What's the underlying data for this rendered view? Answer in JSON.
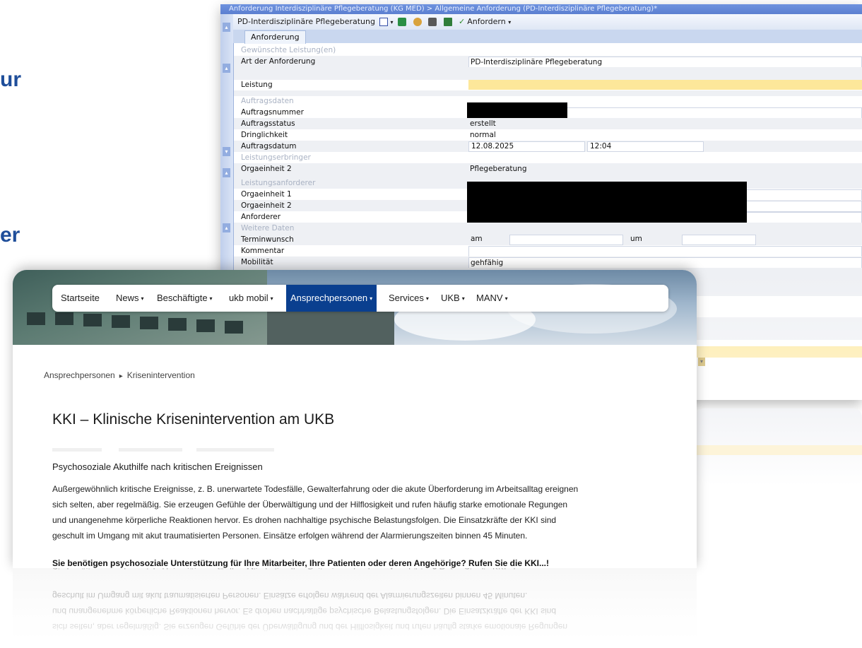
{
  "slide": {
    "fragment_top": "ur",
    "fragment_bottom": "er"
  },
  "order_form": {
    "window_title": "Anforderung Interdisziplinäre Pflegeberatung (KG MED) > Allgemeine Anforderung (PD-Interdisziplinäre Pflegeberatung)*",
    "toolbar": {
      "form_name": "PD-Interdisziplinäre Pflegeberatung",
      "request_button": "Anfordern"
    },
    "tab_label": "Anforderung",
    "sections": {
      "requested_services": "Gewünschte Leistung(en)",
      "order_data": "Auftragsdaten",
      "service_provider": "Leistungserbringer",
      "service_requester": "Leistungsanforderer",
      "additional_data": "Weitere Daten"
    },
    "labels": {
      "request_type": "Art der Anforderung",
      "service": "Leistung",
      "order_number": "Auftragsnummer",
      "order_status": "Auftragsstatus",
      "urgency": "Dringlichkeit",
      "order_date": "Auftragsdatum",
      "org_unit_2_provider": "Orgaeinheit 2",
      "org_unit_1": "Orgaeinheit 1",
      "org_unit_2": "Orgaeinheit 2",
      "requester": "Anforderer",
      "appointment_wish": "Terminwunsch",
      "comment": "Kommentar",
      "mobility": "Mobilität"
    },
    "values": {
      "request_type": "PD-Interdisziplinäre Pflegeberatung",
      "order_status": "erstellt",
      "urgency": "normal",
      "order_date": "12.08.2025",
      "order_time": "12:04",
      "provider_org_unit": "Pflegeberatung",
      "appointment_am": "am",
      "appointment_um": "um",
      "mobility": "gehfähig"
    }
  },
  "intranet": {
    "nav": [
      {
        "label": "Startseite",
        "caret": false
      },
      {
        "label": "News",
        "caret": true
      },
      {
        "label": "Beschäftigte",
        "caret": true
      },
      {
        "label": "ukb mobil",
        "caret": true
      },
      {
        "label": "Ansprechpersonen",
        "caret": true,
        "active": true
      },
      {
        "label": "Services",
        "caret": true
      },
      {
        "label": "UKB",
        "caret": true
      },
      {
        "label": "MANV",
        "caret": true
      }
    ],
    "breadcrumb": {
      "parent": "Ansprechpersonen",
      "current": "Krisenintervention"
    },
    "title": "KKI – Klinische Krisenintervention am UKB",
    "section_heading": "Psychosoziale Akuthilfe nach kritischen Ereignissen",
    "body_lines": [
      "Außergewöhnlich kritische Ereignisse, z. B. unerwartete Todesfälle, Gewalterfahrung oder die akute Überforderung im Arbeitsalltag ereignen",
      "sich selten, aber regelmäßig. Sie erzeugen Gefühle der Überwältigung und der Hilflosigkeit und rufen häufig starke emotionale Regungen",
      "und unangenehme körperliche Reaktionen hervor. Es drohen nachhaltige psychische Belastungsfolgen. Die Einsatzkräfte der KKI sind",
      "geschult im Umgang mit akut traumatisierten Personen. Einsätze erfolgen während der Alarmierungszeiten binnen 45 Minuten."
    ],
    "call_to_action": "Sie benötigen psychosoziale Unterstützung für Ihre Mitarbeiter, Ihre Patienten oder deren Angehörige? Rufen Sie die KKI...!"
  },
  "icons": {
    "caret": "▾",
    "breadcrumb_separator": "▸",
    "toolbar": [
      "document-icon",
      "save-icon",
      "settings-icon",
      "print-icon",
      "export-icon",
      "checkmark-icon"
    ]
  },
  "colors": {
    "nav_active": "#0a3f8f",
    "slide_text": "#1f4e9a",
    "titlebar": "#5b7fd0",
    "required_field": "#fde79a"
  }
}
